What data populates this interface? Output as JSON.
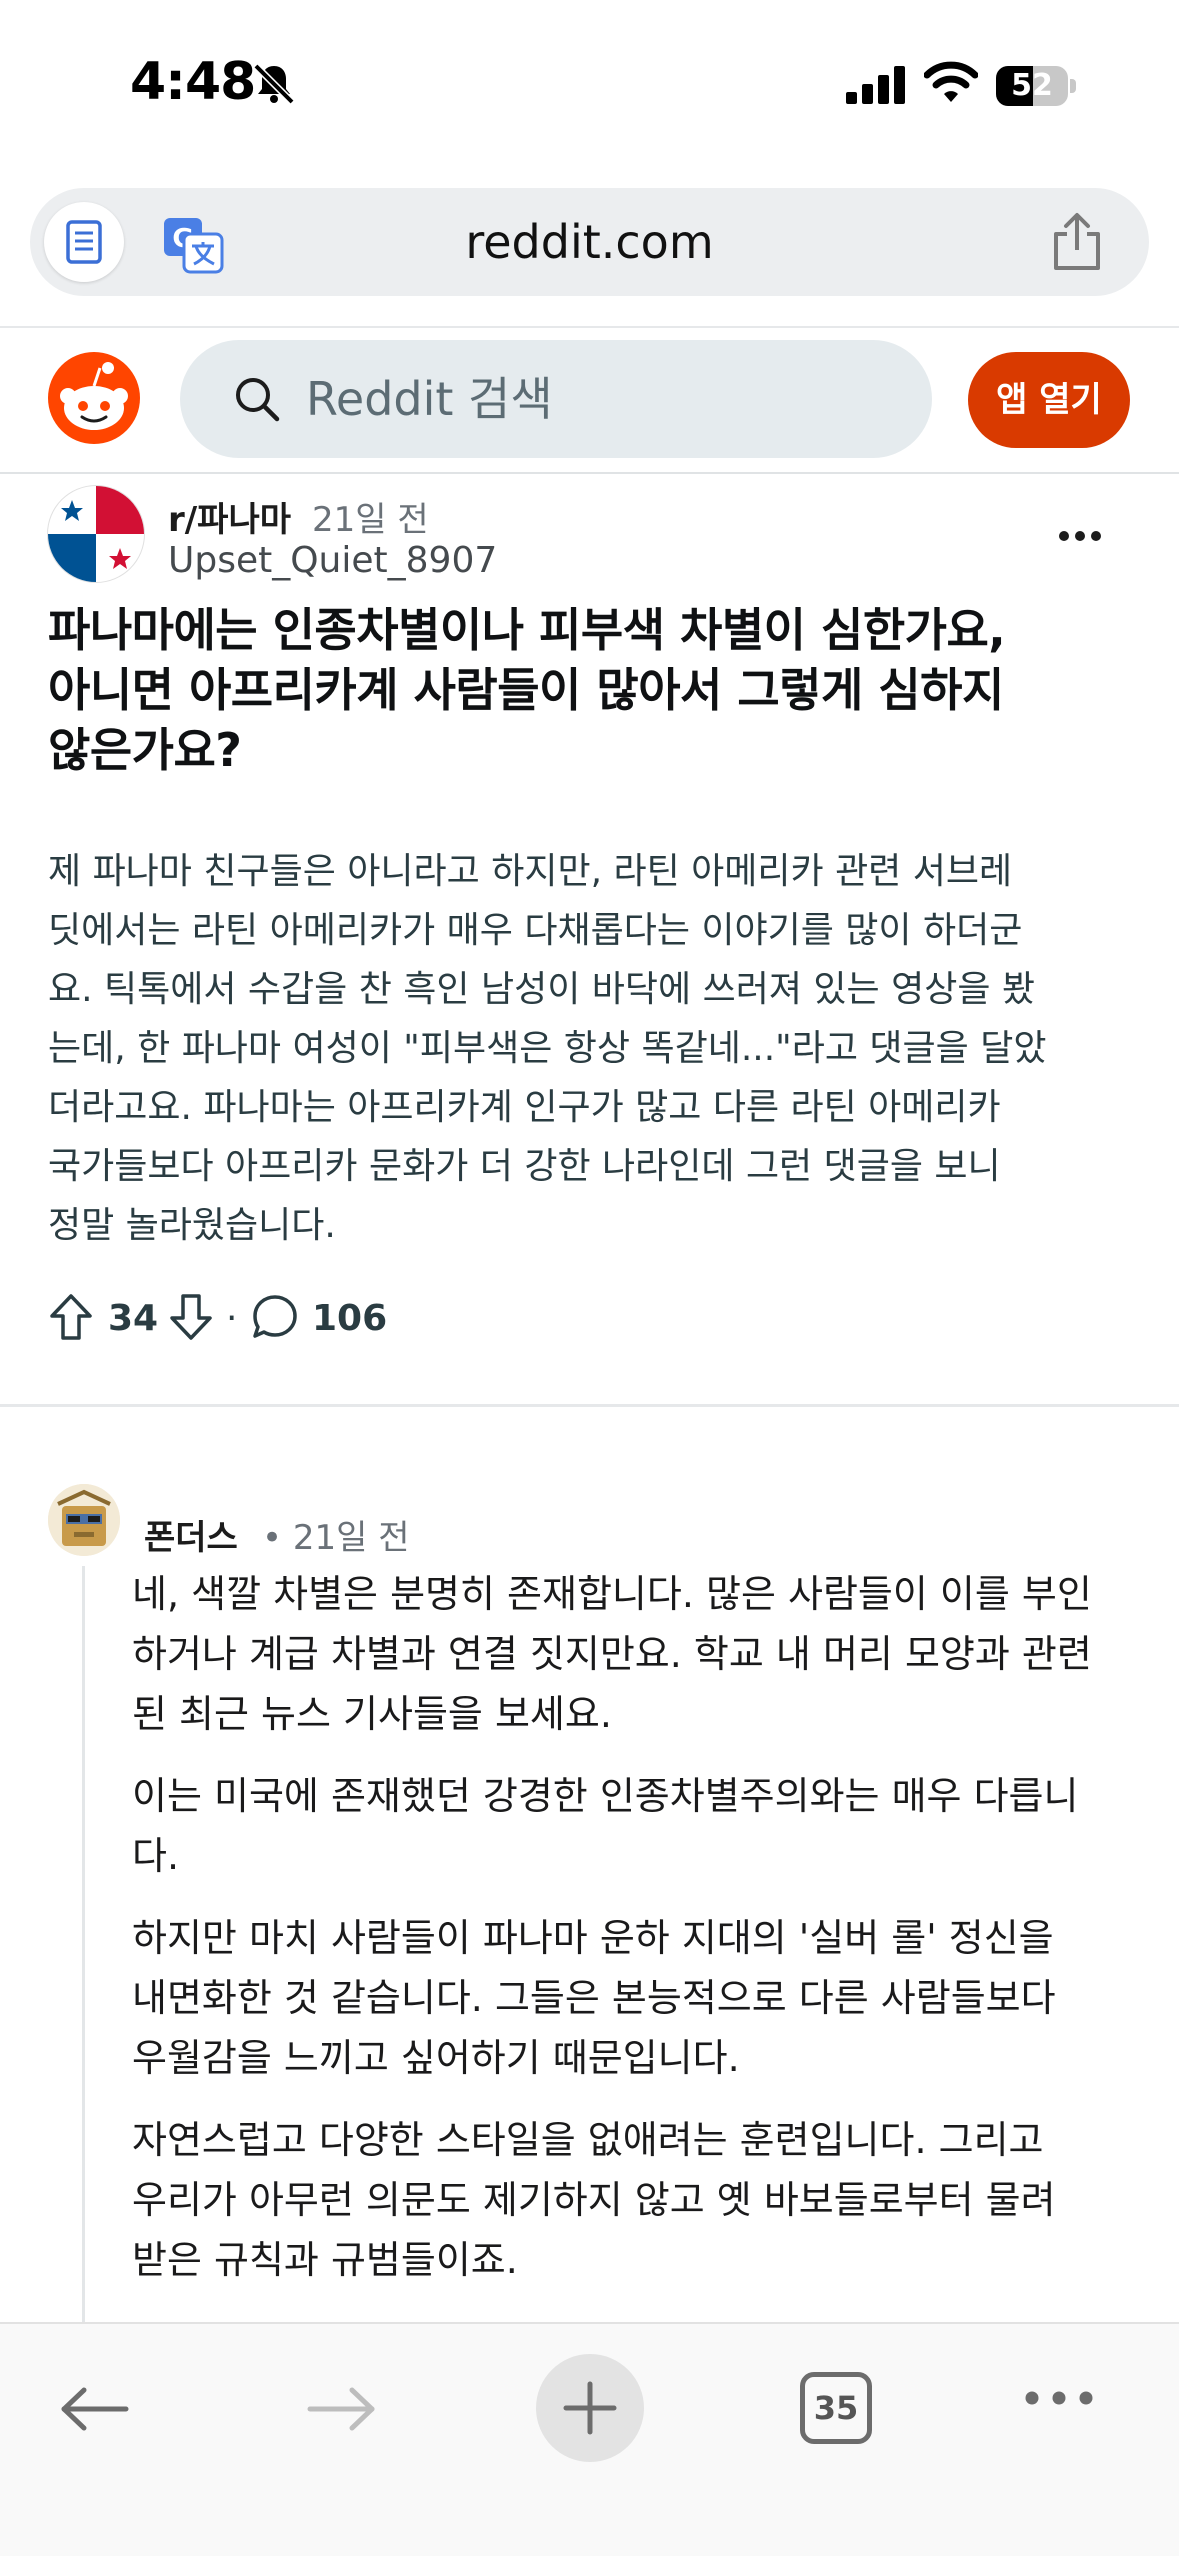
{
  "status_bar": {
    "time": "4:48",
    "battery_level": "52",
    "battery_fraction": 0.52
  },
  "browser": {
    "url": "reddit.com",
    "open_tabs": "35"
  },
  "reddit_header": {
    "search_placeholder": "Reddit 검색",
    "open_app_label": "앱 열기"
  },
  "post": {
    "subreddit": "r/파나마",
    "time": "21일 전",
    "author": "Upset_Quiet_8907",
    "title_lines": [
      "파나마에는 인종차별이나 피부색 차별이 심한가요,",
      "아니면 아프리카계 사람들이 많아서 그렇게 심하지",
      "않은가요?"
    ],
    "body_lines": [
      "제 파나마 친구들은 아니라고 하지만, 라틴 아메리카 관련 서브레",
      "딧에서는 라틴 아메리카가 매우 다채롭다는 이야기를 많이 하더군",
      "요. 틱톡에서 수갑을 찬 흑인 남성이 바닥에 쓰러져 있는 영상을 봤",
      "는데, 한 파나마 여성이 \"피부색은 항상 똑같네...\"라고 댓글을 달았",
      "더라고요. 파나마는 아프리카계 인구가 많고 다른 라틴 아메리카",
      "국가들보다 아프리카 문화가 더 강한 나라인데 그런 댓글을 보니",
      "정말 놀라웠습니다."
    ],
    "upvotes": "34",
    "separator": "·",
    "comments": "106"
  },
  "comment": {
    "author": "폰더스",
    "time": "• 21일 전",
    "paragraphs": [
      [
        "네, 색깔 차별은 분명히 존재합니다. 많은 사람들이 이를 부인",
        "하거나 계급 차별과 연결 짓지만요. 학교 내 머리 모양과 관련",
        "된 최근 뉴스 기사들을 보세요."
      ],
      [
        "이는 미국에 존재했던 강경한 인종차별주의와는 매우 다릅니",
        "다."
      ],
      [
        "하지만 마치 사람들이 파나마 운하 지대의 '실버 롤' 정신을",
        "내면화한 것 같습니다. 그들은 본능적으로 다른 사람들보다",
        "우월감을 느끼고 싶어하기 때문입니다."
      ],
      [
        "자연스럽고 다양한 스타일을 없애려는 훈련입니다. 그리고",
        "우리가 아무런 의문도 제기하지 않고 옛 바보들로부터 물려",
        "받은 규칙과 규범들이죠."
      ]
    ]
  },
  "colors": {
    "reddit_orange": "#ff4500",
    "open_app_bg": "#d93a00",
    "search_bg": "#e5ebee"
  },
  "icons": [
    "bell-slash-icon",
    "signal-icon",
    "wifi-icon",
    "reader-icon",
    "translate-icon",
    "share-icon",
    "reddit-logo-icon",
    "search-icon",
    "more-icon",
    "upvote-icon",
    "downvote-icon",
    "comment-icon",
    "back-icon",
    "forward-icon",
    "plus-icon",
    "tabs-icon",
    "more-horizontal-icon"
  ]
}
